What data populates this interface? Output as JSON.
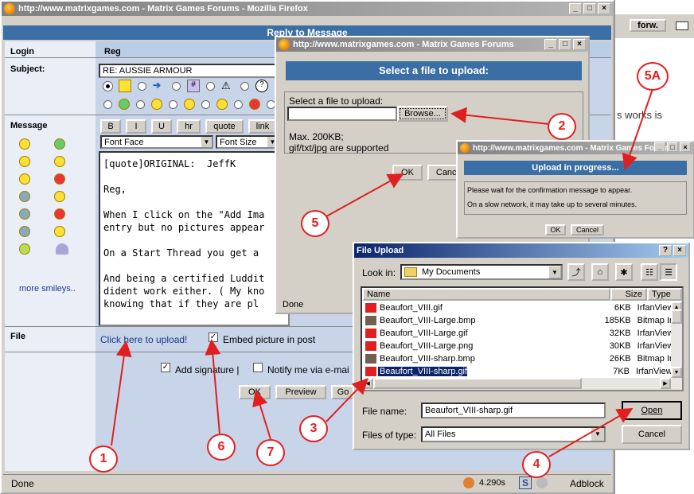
{
  "firefox": {
    "title": "http://www.matrixgames.com - Matrix Games Forums - Mozilla Firefox",
    "status": "Done",
    "time": "4.290s",
    "adblock": "Adblock"
  },
  "reply": {
    "title": "Reply to Message",
    "login_label": "Login",
    "login_value": "Reg",
    "subject_label": "Subject:",
    "subject_value": "RE: AUSSIE ARMOUR",
    "message_label": "Message",
    "file_label": "File",
    "format_buttons": [
      "B",
      "I",
      "U",
      "hr",
      "quote",
      "link"
    ],
    "font_face": "Font Face",
    "font_size": "Font Size",
    "more_smileys": "more smileys..",
    "message_lines": [
      "[quote]ORIGINAL:  JeffK",
      "",
      "Reg,",
      "",
      "When I click on the \"Add Ima",
      "entry but no pictures appear",
      "",
      "On a Start Thread you get a",
      "",
      "And being a certified Luddit",
      "dident work either. ( My kno",
      "knowing that if they are pl"
    ],
    "upload_link": "Click here to upload!",
    "embed_label": "Embed picture in post",
    "add_signature": "Add signature |",
    "notify": "Notify me via e-mai",
    "ok": "OK",
    "preview": "Preview",
    "go": "Go"
  },
  "right_bg": {
    "forward": "forw.",
    "text": "s works is"
  },
  "select_dialog": {
    "title": "http://www.matrixgames.com - Matrix Games Forums",
    "heading": "Select a file to upload:",
    "label": "Select a file to upload:",
    "browse": "Browse...",
    "max": "Max. 200KB;",
    "types": "gif/txt/jpg are supported",
    "ok": "OK",
    "cancel": "Cancel",
    "status": "Done"
  },
  "progress_dialog": {
    "title": "http://www.matrixgames.com - Matrix Games Forums",
    "heading": "Upload in progress...",
    "line1": "Please wait for the confirmation message to appear.",
    "line2": "On a slow network, it may take up to several minutes.",
    "ok": "OK",
    "cancel": "Cancel"
  },
  "file_upload": {
    "title": "File Upload",
    "look_in_label": "Look in:",
    "look_in": "My Documents",
    "columns": [
      "Name",
      "Size",
      "Type"
    ],
    "files": [
      {
        "name": "Beaufort_VIII.gif",
        "size": "6KB",
        "type": "IrfanView GIF"
      },
      {
        "name": "Beaufort_VIII-Large.bmp",
        "size": "185KB",
        "type": "Bitmap Image"
      },
      {
        "name": "Beaufort_VIII-Large.gif",
        "size": "32KB",
        "type": "IrfanView GIF"
      },
      {
        "name": "Beaufort_VIII-Large.png",
        "size": "30KB",
        "type": "IrfanView PNG"
      },
      {
        "name": "Beaufort_VIII-sharp.bmp",
        "size": "26KB",
        "type": "Bitmap Image"
      },
      {
        "name": "Beaufort_VIII-sharp.gif",
        "size": "7KB",
        "type": "IrfanView GIF"
      }
    ],
    "file_name_label": "File name:",
    "file_name": "Beaufort_VIII-sharp.gif",
    "files_of_type_label": "Files of type:",
    "files_of_type": "All Files",
    "open": "Open",
    "cancel": "Cancel"
  },
  "callouts": [
    "1",
    "2",
    "3",
    "4",
    "5",
    "5A",
    "6",
    "7"
  ],
  "colors": {
    "arrow": "#e02020",
    "title_active": "#0a246a",
    "header_blue": "#3a6ea5",
    "selected": "#0a246a"
  }
}
